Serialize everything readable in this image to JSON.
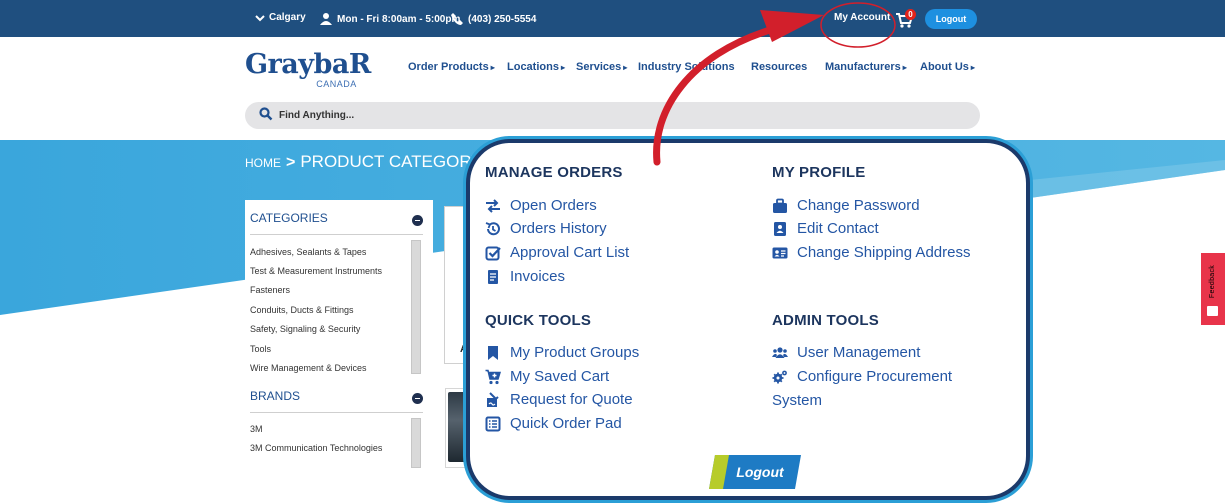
{
  "topbar": {
    "location": "Calgary",
    "hours": "Mon - Fri 8:00am - 5:00pm",
    "phone": "(403) 250-5554",
    "account": "My Account",
    "cart_count": "0",
    "logout": "Logout"
  },
  "logo": {
    "word": "GraybaR",
    "sub": "CANADA"
  },
  "nav": [
    {
      "label": "Order Products",
      "caret": true
    },
    {
      "label": "Locations",
      "caret": true
    },
    {
      "label": "Services",
      "caret": true
    },
    {
      "label": "Industry Solutions",
      "caret": false
    },
    {
      "label": "Resources",
      "caret": false
    },
    {
      "label": "Manufacturers",
      "caret": true
    },
    {
      "label": "About Us",
      "caret": true
    }
  ],
  "search": {
    "placeholder": "Find Anything..."
  },
  "breadcrumb": {
    "home": "HOME",
    "separator": ">",
    "current": "PRODUCT CATEGORY"
  },
  "sidebar": {
    "categories_title": "CATEGORIES",
    "categories": [
      "Adhesives, Sealants & Tapes",
      "Test & Measurement Instruments",
      "Fasteners",
      "Conduits, Ducts & Fittings",
      "Safety, Signaling & Security",
      "Tools",
      "Wire Management & Devices"
    ],
    "brands_title": "BRANDS",
    "brands": [
      "3M",
      "3M Communication Technologies"
    ]
  },
  "card_letter": "A",
  "feedback": "Feedback",
  "popup": {
    "manage_orders": {
      "title": "MANAGE ORDERS",
      "items": [
        "Open Orders",
        "Orders History",
        "Approval Cart List",
        "Invoices"
      ]
    },
    "my_profile": {
      "title": "MY PROFILE",
      "items": [
        "Change Password",
        "Edit Contact",
        "Change Shipping Address"
      ]
    },
    "quick_tools": {
      "title": "QUICK TOOLS",
      "items": [
        "My Product Groups",
        "My Saved Cart",
        "Request for Quote",
        "Quick Order Pad"
      ]
    },
    "admin_tools": {
      "title": "ADMIN TOOLS",
      "items": [
        "User Management",
        "Configure Procurement",
        "System"
      ]
    },
    "logout": "Logout"
  },
  "colors": {
    "topbar": "#1f4f7f",
    "brand_blue": "#1f4f8f",
    "hero_blue": "#3aa6dc",
    "popup_text": "#2456a4",
    "popup_title": "#1c355e",
    "annotation_red": "#d21f2b",
    "logout_button": "#1e90e0",
    "feedback": "#e8344a"
  }
}
